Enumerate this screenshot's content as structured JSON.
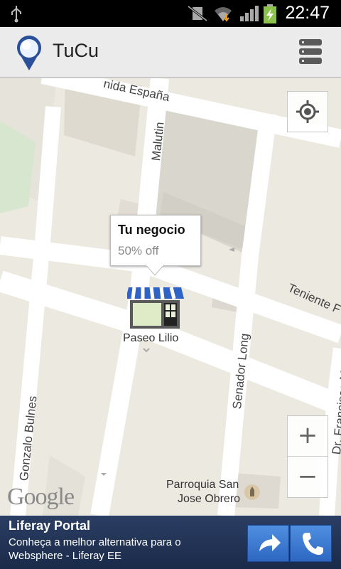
{
  "status_bar": {
    "time": "22:47"
  },
  "app_bar": {
    "title": "TuCu"
  },
  "map": {
    "streets": {
      "espana": "nida España",
      "malutin": "Malutin",
      "teniente": "Teniente F",
      "senador_long": "Senador Long",
      "gonzalo_bulnes": "Gonzalo Bulnes",
      "francisco": "Dr. Francisco Ma"
    },
    "places": {
      "paseo_lilio": "Paseo Lilio",
      "parroquia": "Parroquia San",
      "parroquia_line2": "Jose Obrero"
    },
    "callout": {
      "title": "Tu negocio",
      "subtitle": "50% off"
    },
    "zoom_in_label": "+",
    "zoom_out_label": "−",
    "attribution": "Google"
  },
  "ad": {
    "title": "Liferay Portal",
    "description": "Conheça a melhor alternativa para o Websphere - Liferay EE"
  }
}
